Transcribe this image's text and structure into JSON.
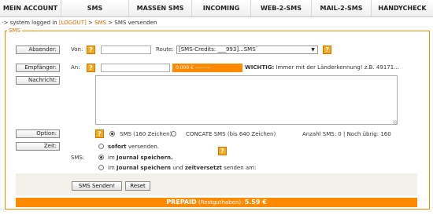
{
  "nav": [
    "MEIN ACCOUNT",
    "SMS",
    "MASSEN SMS",
    "INCOMING",
    "WEB-2-SMS",
    "MAIL-2-SMS",
    "HANDYCHECK"
  ],
  "breadcrumb": {
    "prefix": "-> system logged in ",
    "logout": "[LOGOUT]",
    "sep1": " > ",
    "sms": "SMS",
    "sep2": " > SMS versenden"
  },
  "panel": {
    "legend": "SMS",
    "absender_label": "Absender:",
    "von_label": "Von:",
    "route_label": "Route:",
    "route_value": "[SMS-Credits: ___993]...SMS`",
    "empfaenger_label": "Empfänger:",
    "an_label": "An:",
    "balance": "0.000 € ---------",
    "wichtig_label": "WICHTIG:",
    "wichtig_text": " Immer mit der Länderkennung! z.B. 49171...",
    "nachricht_label": "Nachricht:",
    "option_label": "Option:",
    "option_sms": "SMS (160 Zeichen)",
    "option_concat": "CONCATE SMS (bis 640 Zeichen)",
    "anzahl": "Anzahl SMS: 0  |  Noch übrig: 160",
    "zeit_label": "Zeit:",
    "sms_label": "SMS:",
    "zeit_opt1_b": "sofort",
    "zeit_opt1_t": " versenden.",
    "zeit_opt2_a": "im ",
    "zeit_opt2_b": "Journal speichern.",
    "zeit_opt3_a": "im ",
    "zeit_opt3_b": "Journal speichern",
    "zeit_opt3_c": " und ",
    "zeit_opt3_d": "zeitversetzt",
    "zeit_opt3_e": " senden am:",
    "send_button": "SMS Senden!",
    "reset_button": "Reset"
  },
  "prepaid": {
    "label": "PREPAID",
    "sub": " (Restguthaben): ",
    "amount": "5.59 €"
  },
  "help_glyph": "?",
  "colors": {
    "accent": "#ff8a00",
    "help": "#f4a81c"
  }
}
